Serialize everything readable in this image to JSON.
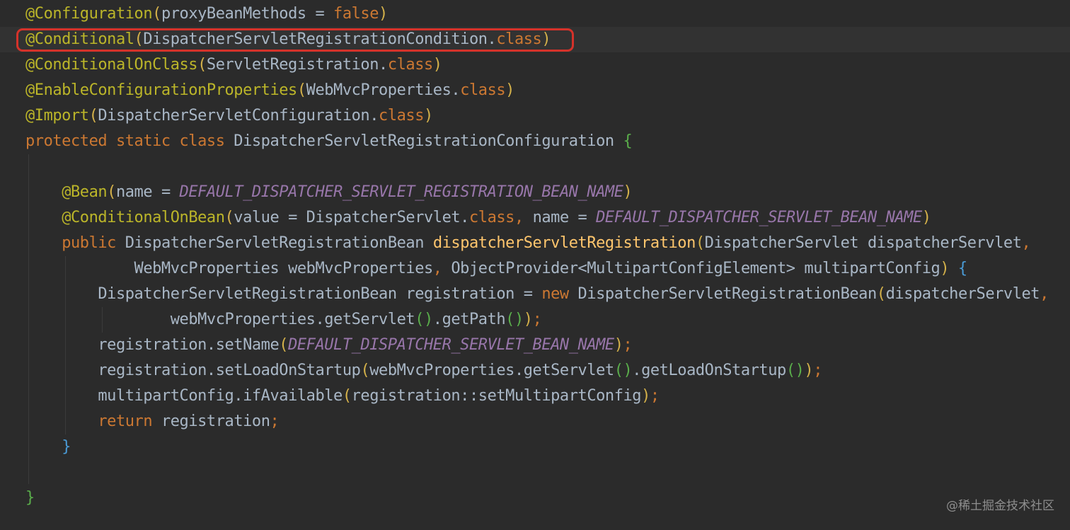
{
  "editor": {
    "colors": {
      "background": "#2b2b2b",
      "current_line": "#323232",
      "default_text": "#a9b7c6",
      "annotation": "#bbb529",
      "keyword": "#cc7832",
      "constant": "#9876aa",
      "method_declaration": "#ffc66d",
      "highlight_box": "#d5322a"
    },
    "lines": [
      {
        "indent": "",
        "tokens": [
          {
            "t": "@Configuration",
            "c": "annot"
          },
          {
            "t": "(",
            "c": "br1"
          },
          {
            "t": "proxyBeanMethods = "
          },
          {
            "t": "false",
            "c": "kw"
          },
          {
            "t": ")",
            "c": "br1"
          }
        ]
      },
      {
        "indent": "",
        "current": true,
        "tokens": [
          {
            "t": "@Conditional",
            "c": "annot"
          },
          {
            "t": "(",
            "c": "br1"
          },
          {
            "t": "DispatcherServletRegistrationCondition."
          },
          {
            "t": "class",
            "c": "kw"
          },
          {
            "t": ")",
            "c": "br1"
          }
        ]
      },
      {
        "indent": "",
        "tokens": [
          {
            "t": "@ConditionalOnClass",
            "c": "annot"
          },
          {
            "t": "(",
            "c": "br1"
          },
          {
            "t": "ServletRegistration."
          },
          {
            "t": "class",
            "c": "kw"
          },
          {
            "t": ")",
            "c": "br1"
          }
        ]
      },
      {
        "indent": "",
        "tokens": [
          {
            "t": "@EnableConfigurationProperties",
            "c": "annot"
          },
          {
            "t": "(",
            "c": "br1"
          },
          {
            "t": "WebMvcProperties."
          },
          {
            "t": "class",
            "c": "kw"
          },
          {
            "t": ")",
            "c": "br1"
          }
        ]
      },
      {
        "indent": "",
        "tokens": [
          {
            "t": "@Import",
            "c": "annot"
          },
          {
            "t": "(",
            "c": "br1"
          },
          {
            "t": "DispatcherServletConfiguration."
          },
          {
            "t": "class",
            "c": "kw"
          },
          {
            "t": ")",
            "c": "br1"
          }
        ]
      },
      {
        "indent": "",
        "tokens": [
          {
            "t": "protected static class ",
            "c": "kw"
          },
          {
            "t": "DispatcherServletRegistrationConfiguration "
          },
          {
            "t": "{",
            "c": "br3"
          }
        ]
      },
      {
        "indent": "",
        "tokens": []
      },
      {
        "indent": "    ",
        "tokens": [
          {
            "t": "@Bean",
            "c": "annot"
          },
          {
            "t": "(",
            "c": "br1"
          },
          {
            "t": "name = "
          },
          {
            "t": "DEFAULT_DISPATCHER_SERVLET_REGISTRATION_BEAN_NAME",
            "c": "const"
          },
          {
            "t": ")",
            "c": "br1"
          }
        ]
      },
      {
        "indent": "    ",
        "tokens": [
          {
            "t": "@ConditionalOnBean",
            "c": "annot"
          },
          {
            "t": "(",
            "c": "br1"
          },
          {
            "t": "value = DispatcherServlet."
          },
          {
            "t": "class",
            "c": "kw"
          },
          {
            "t": ", ",
            "c": "kw"
          },
          {
            "t": "name = "
          },
          {
            "t": "DEFAULT_DISPATCHER_SERVLET_BEAN_NAME",
            "c": "const"
          },
          {
            "t": ")",
            "c": "br1"
          }
        ]
      },
      {
        "indent": "    ",
        "tokens": [
          {
            "t": "public ",
            "c": "kw"
          },
          {
            "t": "DispatcherServletRegistrationBean "
          },
          {
            "t": "dispatcherServletRegistration",
            "c": "method"
          },
          {
            "t": "(",
            "c": "br1"
          },
          {
            "t": "DispatcherServlet dispatcherServlet"
          },
          {
            "t": ",",
            "c": "kw"
          }
        ]
      },
      {
        "indent": "            ",
        "tokens": [
          {
            "t": "WebMvcProperties webMvcProperties"
          },
          {
            "t": ", ",
            "c": "kw"
          },
          {
            "t": "ObjectProvider<MultipartConfigElement> multipartConfig"
          },
          {
            "t": ")",
            "c": "br1"
          },
          {
            "t": " "
          },
          {
            "t": "{",
            "c": "br2"
          }
        ]
      },
      {
        "indent": "        ",
        "tokens": [
          {
            "t": "DispatcherServletRegistrationBean registration = "
          },
          {
            "t": "new ",
            "c": "kw"
          },
          {
            "t": "DispatcherServletRegistrationBean"
          },
          {
            "t": "(",
            "c": "br1"
          },
          {
            "t": "dispatcherServlet"
          },
          {
            "t": ",",
            "c": "kw"
          }
        ]
      },
      {
        "indent": "                ",
        "tokens": [
          {
            "t": "webMvcProperties.getServlet"
          },
          {
            "t": "()",
            "c": "br3"
          },
          {
            "t": ".getPath"
          },
          {
            "t": "()",
            "c": "br3"
          },
          {
            "t": ")",
            "c": "br1"
          },
          {
            "t": ";",
            "c": "kw"
          }
        ]
      },
      {
        "indent": "        ",
        "tokens": [
          {
            "t": "registration.setName"
          },
          {
            "t": "(",
            "c": "br1"
          },
          {
            "t": "DEFAULT_DISPATCHER_SERVLET_BEAN_NAME",
            "c": "const"
          },
          {
            "t": ")",
            "c": "br1"
          },
          {
            "t": ";",
            "c": "kw"
          }
        ]
      },
      {
        "indent": "        ",
        "tokens": [
          {
            "t": "registration.setLoadOnStartup"
          },
          {
            "t": "(",
            "c": "br1"
          },
          {
            "t": "webMvcProperties.getServlet"
          },
          {
            "t": "()",
            "c": "br3"
          },
          {
            "t": ".getLoadOnStartup"
          },
          {
            "t": "()",
            "c": "br3"
          },
          {
            "t": ")",
            "c": "br1"
          },
          {
            "t": ";",
            "c": "kw"
          }
        ]
      },
      {
        "indent": "        ",
        "tokens": [
          {
            "t": "multipartConfig.ifAvailable"
          },
          {
            "t": "(",
            "c": "br1"
          },
          {
            "t": "registration::setMultipartConfig"
          },
          {
            "t": ")",
            "c": "br1"
          },
          {
            "t": ";",
            "c": "kw"
          }
        ]
      },
      {
        "indent": "        ",
        "tokens": [
          {
            "t": "return ",
            "c": "kw"
          },
          {
            "t": "registration"
          },
          {
            "t": ";",
            "c": "kw"
          }
        ]
      },
      {
        "indent": "    ",
        "tokens": [
          {
            "t": "}",
            "c": "br2"
          }
        ]
      },
      {
        "indent": "",
        "tokens": []
      },
      {
        "indent": "",
        "tokens": [
          {
            "t": "}",
            "c": "br3"
          }
        ]
      }
    ]
  },
  "watermark": {
    "text": "@稀土掘金技术社区"
  }
}
